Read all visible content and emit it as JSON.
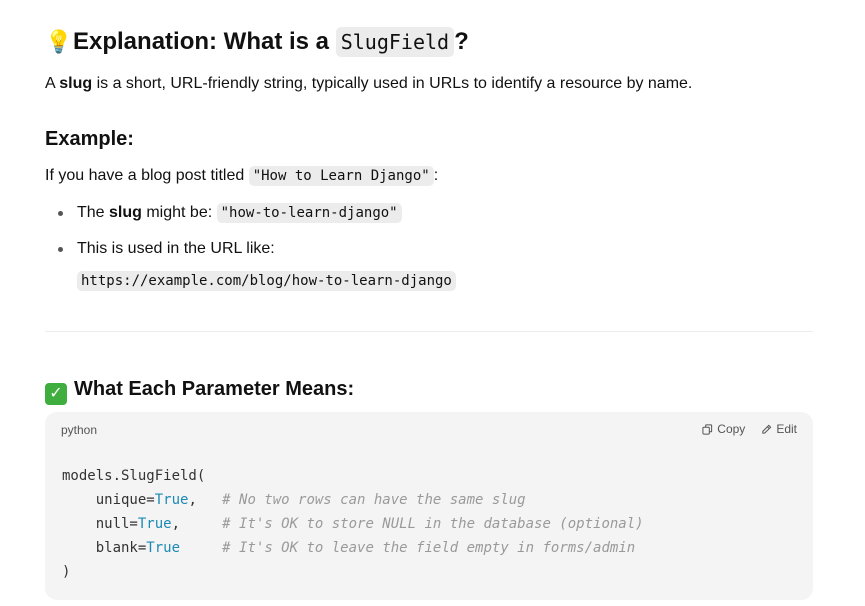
{
  "heading": {
    "emoji": "💡",
    "text": "Explanation: What is a ",
    "code": "SlugField",
    "suffix": "?"
  },
  "lead": {
    "prefix": "A ",
    "bold": "slug",
    "rest": " is a short, URL-friendly string, typically used in URLs to identify a resource by name."
  },
  "example": {
    "heading": "Example:",
    "intro_prefix": "If you have a blog post titled ",
    "intro_code": "\"How to Learn Django\"",
    "intro_suffix": ":",
    "bullets": [
      {
        "prefix": "The ",
        "bold": "slug",
        "mid": " might be: ",
        "code": "\"how-to-learn-django\""
      },
      {
        "text": "This is used in the URL like:",
        "code": "https://example.com/blog/how-to-learn-django"
      }
    ]
  },
  "params": {
    "icon": "check-mark-icon",
    "heading": "What Each Parameter Means:"
  },
  "codeblock": {
    "language": "python",
    "copy_label": "Copy",
    "edit_label": "Edit",
    "lines": {
      "l1": "models.SlugField(",
      "l2_a": "    unique=",
      "l2_b": "True",
      "l2_c": ",   ",
      "l2_d": "# No two rows can have the same slug",
      "l3_a": "    null=",
      "l3_b": "True",
      "l3_c": ",     ",
      "l3_d": "# It's OK to store NULL in the database (optional)",
      "l4_a": "    blank=",
      "l4_b": "True",
      "l4_c": "     ",
      "l4_d": "# It's OK to leave the field empty in forms/admin",
      "l5": ")"
    }
  },
  "colors": {
    "keyword": "#1c8ab4",
    "comment": "#9a9a9a",
    "code_bg": "#f4f4f4",
    "check_bg": "#3fae3f"
  }
}
